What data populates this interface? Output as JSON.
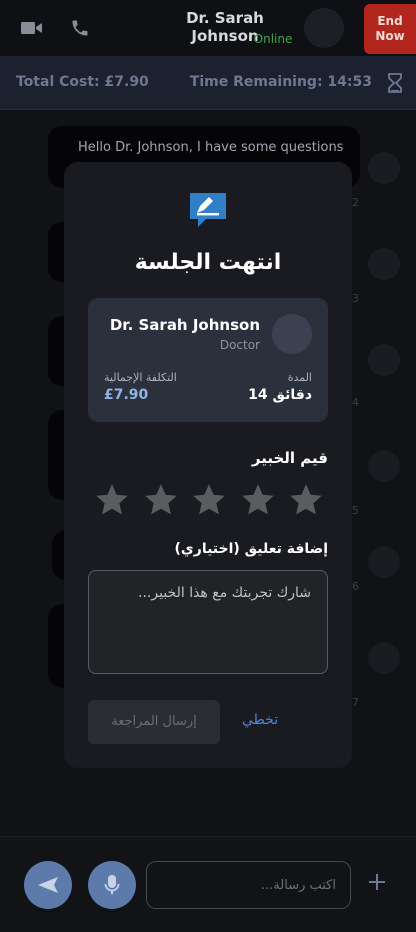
{
  "header": {
    "video_icon": "video-camera-icon",
    "phone_icon": "phone-icon",
    "title": "Dr. Sarah Johnson",
    "status": "Online",
    "end_button": "End\nNow",
    "colors": {
      "end": "#b3261e",
      "online": "#3fa34d"
    }
  },
  "infobar": {
    "total_cost": "Total Cost: £7.90",
    "time_remaining": "Time Remaining: 14:53",
    "timer_icon": "hourglass-icon"
  },
  "chat": {
    "first_message": "Hello Dr. Johnson, I have some questions",
    "side_numbers": [
      "2",
      "3",
      "4",
      "5",
      "6",
      "7"
    ]
  },
  "modal": {
    "icon": "edit-note-icon",
    "title": "انتهت الجلسة",
    "expert": {
      "name": "Dr. Sarah Johnson",
      "role": "Doctor"
    },
    "total_cost_label": "التكلفة الإجمالية",
    "total_cost_value": "£7.90",
    "duration_label": "المدة",
    "duration_value": "14 دقائق",
    "rate_label": "قيم الخبير",
    "rating": {
      "value": 0,
      "max": 5
    },
    "comment_label": "إضافة تعليق (اختياري)",
    "comment_placeholder": "شارك تجربتك مع هذا الخبير...",
    "submit_button": "إرسال المراجعة",
    "skip_link": "تخطي",
    "accent": "#4f86d4"
  },
  "footer": {
    "send_icon": "send-icon",
    "mic_icon": "microphone-icon",
    "message_placeholder": "اكتب رسالة...",
    "add_icon": "plus-icon"
  }
}
